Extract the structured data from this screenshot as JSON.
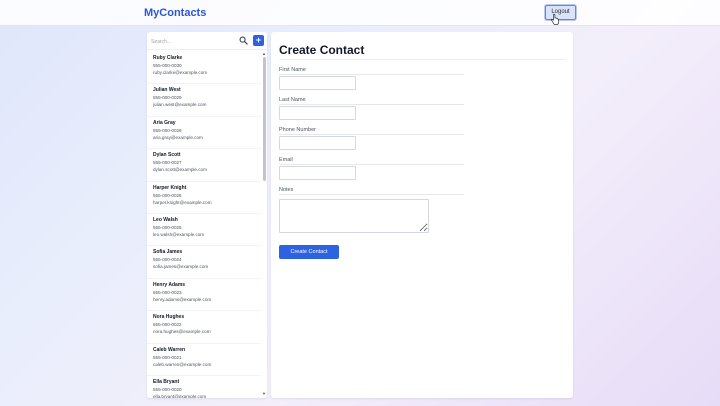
{
  "app": {
    "brand": "MyContacts",
    "logout_label": "Logout"
  },
  "search": {
    "placeholder": "Search..."
  },
  "add_label": "+",
  "contacts": [
    {
      "name": "Ruby Clarke",
      "phone": "555-000-0030",
      "email": "ruby.clarke@example.com"
    },
    {
      "name": "Julian West",
      "phone": "555-000-0029",
      "email": "julian.west@example.com"
    },
    {
      "name": "Aria Gray",
      "phone": "555-000-0028",
      "email": "aria.gray@example.com"
    },
    {
      "name": "Dylan Scott",
      "phone": "555-000-0027",
      "email": "dylan.scott@example.com"
    },
    {
      "name": "Harper Knight",
      "phone": "555-000-0026",
      "email": "harper.knight@example.com"
    },
    {
      "name": "Leo Walsh",
      "phone": "555-000-0025",
      "email": "leo.walsh@example.com"
    },
    {
      "name": "Sofia James",
      "phone": "555-000-0024",
      "email": "sofia.james@example.com"
    },
    {
      "name": "Henry Adams",
      "phone": "555-000-0023",
      "email": "henry.adams@example.com"
    },
    {
      "name": "Nora Hughes",
      "phone": "555-000-0022",
      "email": "nora.hughes@example.com"
    },
    {
      "name": "Caleb Warren",
      "phone": "555-000-0021",
      "email": "caleb.warren@example.com"
    },
    {
      "name": "Ella Bryant",
      "phone": "555-000-0020",
      "email": "ella.bryant@example.com"
    }
  ],
  "form": {
    "title": "Create Contact",
    "first_name_label": "First Name",
    "first_name_value": "",
    "last_name_label": "Last Name",
    "last_name_value": "",
    "phone_label": "Phone Number",
    "phone_value": "",
    "email_label": "Email",
    "email_value": "",
    "notes_label": "Notes",
    "notes_value": "",
    "submit_label": "Create Contact"
  },
  "colors": {
    "accent": "#2d63e0",
    "brand": "#2b55d6"
  },
  "icons": {
    "search": "search-icon",
    "add": "plus-icon",
    "cursor": "pointer-cursor-icon"
  }
}
